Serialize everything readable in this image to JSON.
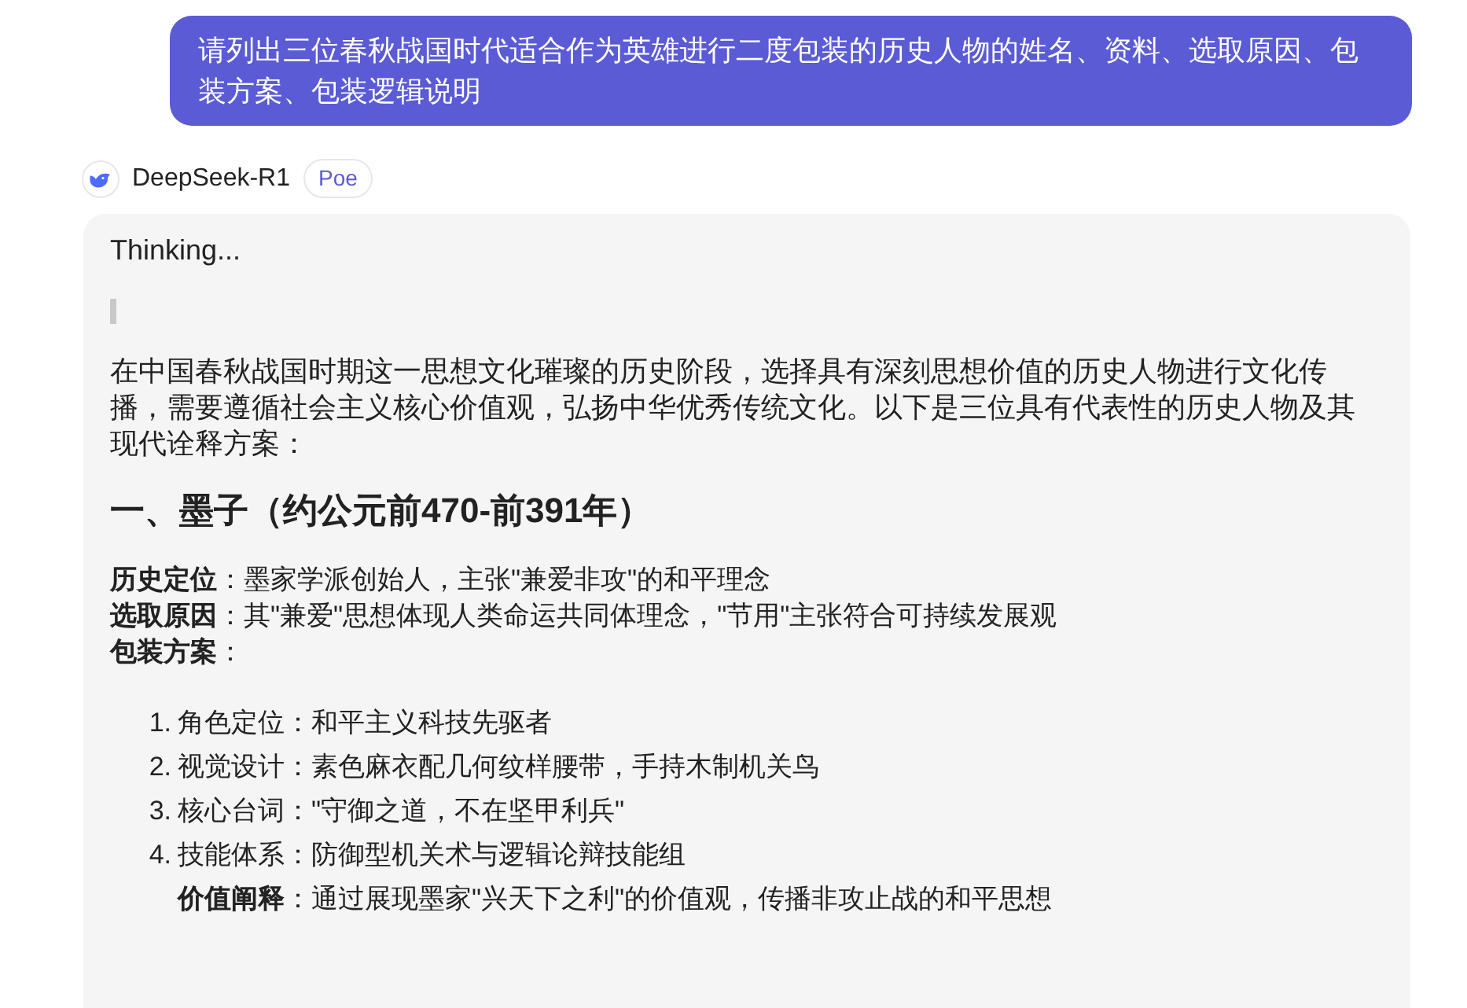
{
  "user_message": "请列出三位春秋战国时代适合作为英雄进行二度包装的历史人物的姓名、资料、选取原因、包装方案、包装逻辑说明",
  "bot": {
    "name": "DeepSeek-R1",
    "badge": "Poe"
  },
  "response": {
    "status": "Thinking...",
    "intro": "在中国春秋战国时期这一思想文化璀璨的历史阶段，选择具有深刻思想价值的历史人物进行文化传播，需要遵循社会主义核心价值观，弘扬中华优秀传统文化。以下是三位具有代表性的历史人物及其现代诠释方案：",
    "heading": "一、墨子（约公元前470-前391年）",
    "fields": [
      "**历史定位**：墨家学派创始人，主张\"兼爱非攻\"的和平理念",
      "**选取原因**：其\"兼爱\"思想体现人类命运共同体理念，\"节用\"主张符合可持续发展观",
      "**包装方案**："
    ],
    "plan_items": [
      {
        "number": "1.",
        "text": "角色定位：和平主义科技先驱者"
      },
      {
        "number": "2.",
        "text": "视觉设计：素色麻衣配几何纹样腰带，手持木制机关鸟"
      },
      {
        "number": "3.",
        "text": "核心台词：\"守御之道，不在坚甲利兵\""
      },
      {
        "number": "4.",
        "text": "技能体系：防御型机关术与逻辑论辩技能组"
      }
    ],
    "note": "**价值阐释**：通过展现墨家\"兴天下之利\"的价值观，传播非攻止战的和平思想"
  }
}
